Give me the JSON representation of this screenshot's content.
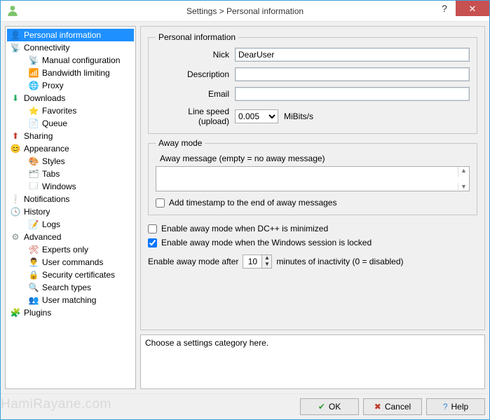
{
  "window": {
    "title": "Settings > Personal information"
  },
  "tree": {
    "items": [
      {
        "label": "Personal information",
        "icon": "👤",
        "iconColor": "#4caf50",
        "depth": 0,
        "selected": true
      },
      {
        "label": "Connectivity",
        "icon": "📡",
        "iconColor": "#d35400",
        "depth": 0
      },
      {
        "label": "Manual configuration",
        "icon": "📡",
        "iconColor": "#d35400",
        "depth": 1
      },
      {
        "label": "Bandwidth limiting",
        "icon": "📶",
        "iconColor": "#2e86de",
        "depth": 1
      },
      {
        "label": "Proxy",
        "icon": "🌐",
        "iconColor": "#2e86de",
        "depth": 1
      },
      {
        "label": "Downloads",
        "icon": "⬇",
        "iconColor": "#27ae60",
        "depth": 0
      },
      {
        "label": "Favorites",
        "icon": "⭐",
        "iconColor": "#f1c40f",
        "depth": 1
      },
      {
        "label": "Queue",
        "icon": "📄",
        "iconColor": "#7f8c8d",
        "depth": 1
      },
      {
        "label": "Sharing",
        "icon": "⬆",
        "iconColor": "#c0392b",
        "depth": 0
      },
      {
        "label": "Appearance",
        "icon": "😊",
        "iconColor": "#f1c40f",
        "depth": 0
      },
      {
        "label": "Styles",
        "icon": "🎨",
        "iconColor": "#8e44ad",
        "depth": 1
      },
      {
        "label": "Tabs",
        "icon": "🗂",
        "iconColor": "#7f8c8d",
        "depth": 1
      },
      {
        "label": "Windows",
        "icon": "🗔",
        "iconColor": "#7f8c8d",
        "depth": 1
      },
      {
        "label": "Notifications",
        "icon": "❕",
        "iconColor": "#333",
        "depth": 0
      },
      {
        "label": "History",
        "icon": "🕓",
        "iconColor": "#333",
        "depth": 0
      },
      {
        "label": "Logs",
        "icon": "📝",
        "iconColor": "#7f8c8d",
        "depth": 1
      },
      {
        "label": "Advanced",
        "icon": "⚙",
        "iconColor": "#7f8c8d",
        "depth": 0
      },
      {
        "label": "Experts only",
        "icon": "🛠",
        "iconColor": "#c0392b",
        "depth": 1
      },
      {
        "label": "User commands",
        "icon": "👨‍💼",
        "iconColor": "#2e86de",
        "depth": 1
      },
      {
        "label": "Security certificates",
        "icon": "🔒",
        "iconColor": "#f39c12",
        "depth": 1
      },
      {
        "label": "Search types",
        "icon": "🔍",
        "iconColor": "#2e86de",
        "depth": 1
      },
      {
        "label": "User matching",
        "icon": "👥",
        "iconColor": "#27ae60",
        "depth": 1
      },
      {
        "label": "Plugins",
        "icon": "🧩",
        "iconColor": "#2e86de",
        "depth": 0
      }
    ]
  },
  "personal": {
    "legend": "Personal information",
    "nick_label": "Nick",
    "nick_value": "DearUser",
    "desc_label": "Description",
    "desc_value": "",
    "email_label": "Email",
    "email_value": "",
    "linespeed_label": "Line speed (upload)",
    "linespeed_value": "0.005",
    "linespeed_unit": "MiBits/s"
  },
  "away": {
    "legend": "Away mode",
    "msg_label": "Away message (empty = no away message)",
    "msg_value": "",
    "timestamp_label": "Add timestamp to the end of away messages",
    "timestamp_checked": false,
    "minimized_label": "Enable away mode when DC++ is minimized",
    "minimized_checked": false,
    "locked_label": "Enable away mode when the Windows session is locked",
    "locked_checked": true,
    "after_pre": "Enable away mode after",
    "after_value": "10",
    "after_post": "minutes of inactivity (0 = disabled)"
  },
  "description_box": "Choose a settings category here.",
  "buttons": {
    "ok": "OK",
    "cancel": "Cancel",
    "help": "Help"
  },
  "watermark": "HamiRayane.com"
}
